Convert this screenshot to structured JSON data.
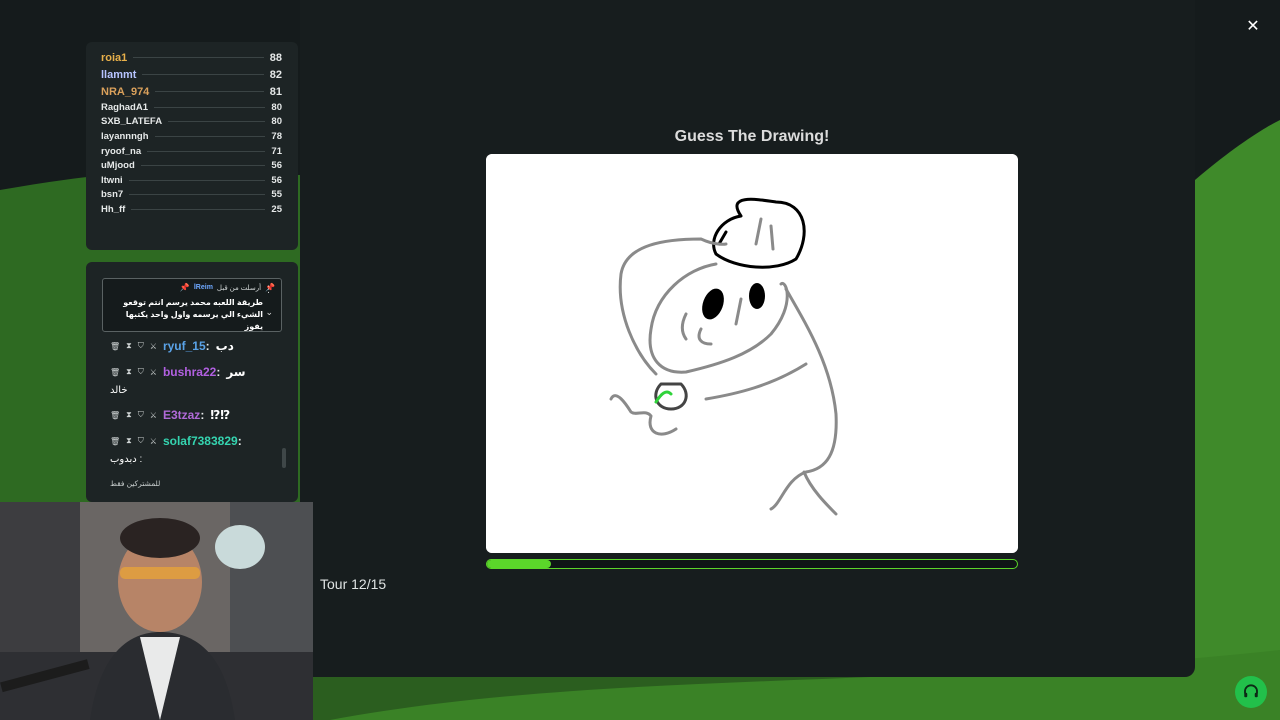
{
  "leaderboard": [
    {
      "name": "roia1",
      "score": "88",
      "color": "#e8b04a",
      "size": "big"
    },
    {
      "name": "llammt",
      "score": "82",
      "color": "#b7c4ff",
      "size": "big"
    },
    {
      "name": "NRA_974",
      "score": "81",
      "color": "#d9a05b",
      "size": "big"
    },
    {
      "name": "RaghadA1",
      "score": "80",
      "color": "#e6e9e9",
      "size": "small"
    },
    {
      "name": "SXB_LATEFA",
      "score": "80",
      "color": "#e6e9e9",
      "size": "small"
    },
    {
      "name": "layannngh",
      "score": "78",
      "color": "#e6e9e9",
      "size": "small"
    },
    {
      "name": "ryoof_na",
      "score": "71",
      "color": "#e6e9e9",
      "size": "small"
    },
    {
      "name": "uMjood",
      "score": "56",
      "color": "#e6e9e9",
      "size": "small"
    },
    {
      "name": "ltwni",
      "score": "56",
      "color": "#e6e9e9",
      "size": "small"
    },
    {
      "name": "bsn7",
      "score": "55",
      "color": "#e6e9e9",
      "size": "small"
    },
    {
      "name": "Hh_ff",
      "score": "25",
      "color": "#e6e9e9",
      "size": "small"
    }
  ],
  "chat": {
    "pinned": {
      "label": "أرسلت من قبل",
      "user": "lReim",
      "text": "طريقة اللعبه محمد يرسم انتم توقعو الشيء الي يرسمه واول واحد يكتبها يفوز"
    },
    "messages": [
      {
        "user": "ryuf_15",
        "text": "دب",
        "color": "#5aa3e8"
      },
      {
        "user": "bushra22",
        "text": "سر",
        "color": "#b160e0",
        "wrap": "خالد"
      },
      {
        "user": "E3tzaz",
        "text": "⁉⁉",
        "color": "#b16ad8"
      },
      {
        "user": "solaf7383829",
        "text": "",
        "color": "#35d4b0",
        "wrap": "دبدوب :"
      }
    ],
    "footer": "للمشتركين فقط"
  },
  "game": {
    "title": "Guess The Drawing!",
    "round": "Tour 12/15",
    "timer_progress": 0.12,
    "accent": "#5bd62a"
  },
  "icons": {
    "close": "✕",
    "pin": "📌",
    "more": "⋮",
    "chevron": "⌄",
    "trash": "🗑",
    "timeout": "⧗",
    "shield": "⛉",
    "swords": "⚔"
  }
}
